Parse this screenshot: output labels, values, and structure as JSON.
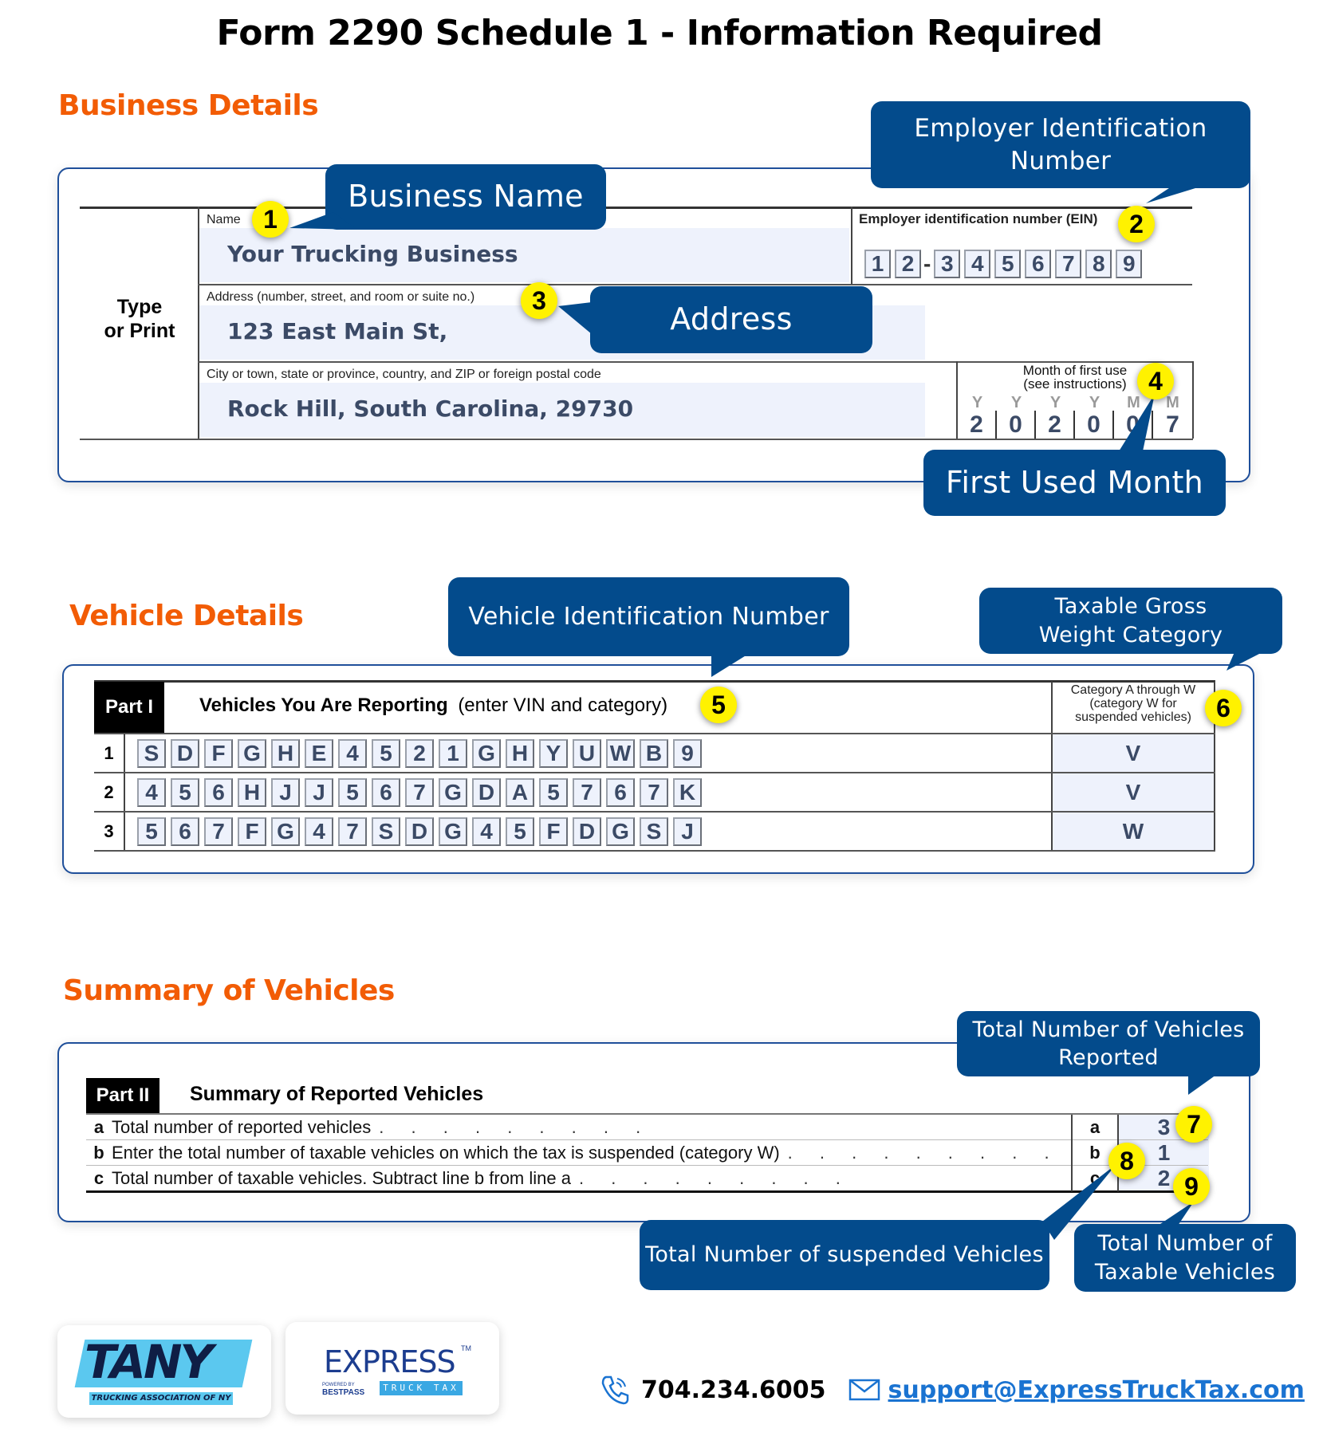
{
  "title": "Form 2290 Schedule 1 - Information Required",
  "sections": {
    "business": "Business Details",
    "vehicle": "Vehicle Details",
    "summary": "Summary of Vehicles"
  },
  "business_form": {
    "side_label_line1": "Type",
    "side_label_line2": "or Print",
    "name_label": "Name",
    "name_value": "Your Trucking Business",
    "ein_label": "Employer identification number (EIN)",
    "ein_digits": [
      "1",
      "2",
      "-",
      "3",
      "4",
      "5",
      "6",
      "7",
      "8",
      "9"
    ],
    "address_label": "Address (number, street, and room or suite no.)",
    "address_value": "123 East Main St,",
    "city_label": "City or town, state or province, country, and ZIP or foreign postal code",
    "city_value": "Rock Hill, South Carolina, 29730",
    "month_label_line1": "Month of first use",
    "month_label_line2": "(see instructions)",
    "month_headers": [
      "Y",
      "Y",
      "Y",
      "Y",
      "M",
      "M"
    ],
    "month_digits": [
      "2",
      "0",
      "2",
      "0",
      "0",
      "7"
    ]
  },
  "vehicle_form": {
    "part_label": "Part I",
    "heading_bold": "Vehicles You Are Reporting",
    "heading_note": "(enter VIN and category)",
    "category_header_line1": "Category A through W",
    "category_header_line2": "(category W for",
    "category_header_line3": "suspended vehicles)",
    "rows": [
      {
        "num": "1",
        "vin": [
          "S",
          "D",
          "F",
          "G",
          "H",
          "E",
          "4",
          "5",
          "2",
          "1",
          "G",
          "H",
          "Y",
          "U",
          "W",
          "B",
          "9"
        ],
        "category": "V"
      },
      {
        "num": "2",
        "vin": [
          "4",
          "5",
          "6",
          "H",
          "J",
          "J",
          "5",
          "6",
          "7",
          "G",
          "D",
          "A",
          "5",
          "7",
          "6",
          "7",
          "K"
        ],
        "category": "V"
      },
      {
        "num": "3",
        "vin": [
          "5",
          "6",
          "7",
          "F",
          "G",
          "4",
          "7",
          "S",
          "D",
          "G",
          "4",
          "5",
          "F",
          "D",
          "G",
          "S",
          "J"
        ],
        "category": "W"
      }
    ]
  },
  "summary_form": {
    "part_label": "Part II",
    "heading": "Summary of Reported Vehicles",
    "rows": [
      {
        "letter": "a",
        "text": "Total number of reported vehicles",
        "value": "3"
      },
      {
        "letter": "b",
        "text": "Enter the total number of taxable vehicles on which the tax is suspended (category W)",
        "value": "1"
      },
      {
        "letter": "c",
        "text": "Total number of taxable vehicles. Subtract line b from line a",
        "value": "2"
      }
    ]
  },
  "callouts": {
    "business_name": "Business Name",
    "ein_line1": "Employer Identification",
    "ein_line2": "Number",
    "address": "Address",
    "first_used_month": "First Used Month",
    "vin": "Vehicle Identification Number",
    "weight_line1": "Taxable Gross",
    "weight_line2": "Weight Category",
    "total_reported_line1": "Total Number of Vehicles",
    "total_reported_line2": "Reported",
    "suspended": "Total Number of suspended Vehicles",
    "taxable_line1": "Total Number of",
    "taxable_line2": "Taxable Vehicles"
  },
  "badges": [
    "1",
    "2",
    "3",
    "4",
    "5",
    "6",
    "7",
    "8",
    "9"
  ],
  "footer": {
    "tany_logo_text": "TANY",
    "tany_logo_sub": "TRUCKING ASSOCIATION OF NY",
    "express_logo_text": "EXPRESS",
    "express_tm": "TM",
    "express_powered": "POWERED BY",
    "express_bestpass": "BESTPASS",
    "express_sub": "TRUCK TAX",
    "phone": "704.234.6005",
    "email": "support@ExpressTruckTax.com"
  },
  "colors": {
    "heading_orange": "#f25c05",
    "callout_blue": "#034b8c",
    "badge_yellow": "#fff200",
    "link_blue": "#1a73d1"
  }
}
